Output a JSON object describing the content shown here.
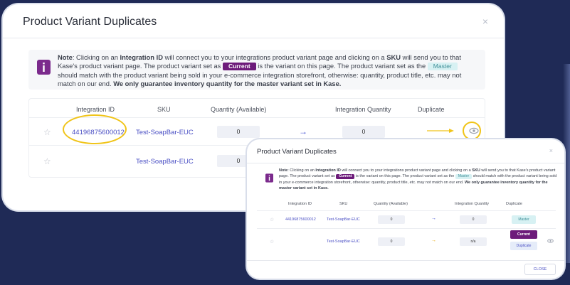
{
  "modal": {
    "title": "Product Variant Duplicates",
    "close_glyph": "×",
    "note": {
      "label": "Note",
      "t1": ": Clicking on an ",
      "integration_id": "Integration ID",
      "t2": " will connect you to your integrations product variant page and clicking on a ",
      "sku": "SKU",
      "t3": " will send you to that Kase's product variant page. The product variant set as ",
      "current": "Current",
      "t4": " is the variant on this page. The product variant set as the ",
      "master": "Master",
      "t5": " should match with the product variant being sold in your e-commerce integration storefront, otherwise: quantity, product title, etc. may not match on our end. ",
      "guarantee": "We only guarantee inventory quantity for the master variant set in Kase."
    },
    "columns": {
      "integration_id": "Integration ID",
      "sku": "SKU",
      "quantity": "Quantity (Available)",
      "integration_quantity": "Integration Quantity",
      "duplicate": "Duplicate"
    },
    "rows": [
      {
        "integration_id": "44196875600012",
        "sku": "Test-SoapBar-EUC",
        "quantity": "0",
        "integration_quantity": "0"
      },
      {
        "integration_id": "",
        "sku": "Test-SoapBar-EUC",
        "quantity": "0",
        "integration_quantity": ""
      }
    ]
  },
  "small_modal": {
    "title": "Product Variant Duplicates",
    "close_glyph": "×",
    "rows": [
      {
        "integration_id": "44196875600012",
        "sku": "Test-SoapBar-EUC",
        "quantity": "0",
        "integration_quantity": "0",
        "duplicate": "Master"
      },
      {
        "integration_id": "",
        "sku": "Test-SoapBar-EUC",
        "quantity": "0",
        "integration_quantity": "n/a",
        "duplicate_current": "Current",
        "duplicate_button": "Duplicate"
      }
    ],
    "footer_close": "CLOSE"
  },
  "icons": {
    "info": "info-icon",
    "star": "star-icon",
    "arrow": "arrow-right-icon",
    "eye": "eye-icon"
  },
  "colors": {
    "accent_purple": "#6d1b7a",
    "link_blue": "#4a4fc4",
    "highlight_yellow": "#f0c419",
    "background": "#1f2a56"
  },
  "glyphs": {
    "star": "☆",
    "arrow": "→"
  }
}
